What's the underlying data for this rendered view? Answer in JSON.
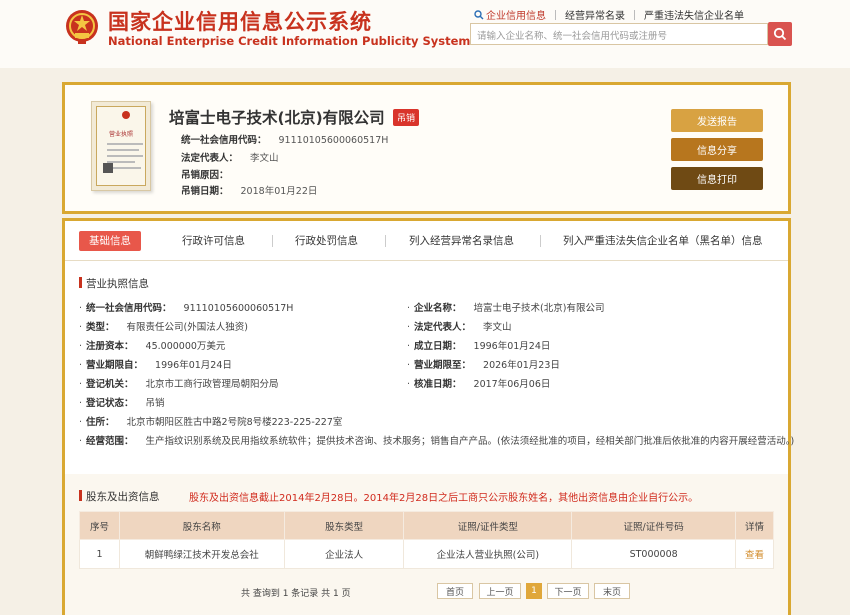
{
  "header": {
    "title_cn": "国家企业信用信息公示系统",
    "title_en": "National Enterprise Credit Information Publicity System",
    "links": [
      "企业信用信息",
      "经营异常名录",
      "严重违法失信企业名单"
    ],
    "search_placeholder": "请输入企业名称、统一社会信用代码或注册号"
  },
  "company": {
    "license_label": "营业执照",
    "name": "培富士电子技术(北京)有限公司",
    "status_badge": "吊销",
    "rows": [
      {
        "label": "统一社会信用代码：",
        "value": "91110105600060517H"
      },
      {
        "label": "法定代表人：",
        "value": "李文山"
      },
      {
        "label": "吊销原因：",
        "value": ""
      },
      {
        "label": "吊销日期：",
        "value": "2018年01月22日"
      }
    ],
    "buttons": [
      "发送报告",
      "信息分享",
      "信息打印"
    ]
  },
  "tabs": [
    "基础信息",
    "行政许可信息",
    "行政处罚信息",
    "列入经营异常名录信息",
    "列入严重违法失信企业名单（黑名单）信息"
  ],
  "license_section": {
    "title": "营业执照信息",
    "left": [
      {
        "label": "统一社会信用代码：",
        "value": "91110105600060517H"
      },
      {
        "label": "类型：",
        "value": "有限责任公司(外国法人独资)"
      },
      {
        "label": "注册资本：",
        "value": "45.000000万美元"
      },
      {
        "label": "营业期限自：",
        "value": "1996年01月24日"
      },
      {
        "label": "登记机关：",
        "value": "北京市工商行政管理局朝阳分局"
      },
      {
        "label": "登记状态：",
        "value": "吊销"
      },
      {
        "label": "住所：",
        "value": "北京市朝阳区胜古中路2号院8号楼223-225-227室"
      },
      {
        "label": "经营范围：",
        "value": "生产指纹识别系统及民用指纹系统软件；提供技术咨询、技术服务；销售自产产品。(依法须经批准的项目，经相关部门批准后依批准的内容开展经营活动。)"
      }
    ],
    "right": [
      {
        "label": "企业名称：",
        "value": "培富士电子技术(北京)有限公司"
      },
      {
        "label": "法定代表人：",
        "value": "李文山"
      },
      {
        "label": "成立日期：",
        "value": "1996年01月24日"
      },
      {
        "label": "营业期限至：",
        "value": "2026年01月23日"
      },
      {
        "label": "核准日期：",
        "value": "2017年06月06日"
      }
    ]
  },
  "shareholders": {
    "title": "股东及出资信息",
    "note": "股东及出资信息截止2014年2月28日。2014年2月28日之后工商只公示股东姓名，其他出资信息由企业自行公示。",
    "columns": [
      "序号",
      "股东名称",
      "股东类型",
      "证照/证件类型",
      "证照/证件号码",
      "详情"
    ],
    "rows": [
      [
        "1",
        "朝鲜鸭绿江技术开发总会社",
        "企业法人",
        "企业法人营业执照(公司)",
        "ST000008",
        "查看"
      ]
    ],
    "pager": {
      "info": "共 查询到 1 条记录 共 1 页",
      "first": "首页",
      "prev": "上一页",
      "current": "1",
      "next": "下一页",
      "last": "末页"
    }
  },
  "colors": {
    "brand_red": "#c8321e",
    "gold_border": "#d9a832",
    "btn_send": "#d8a242",
    "btn_share": "#b7761e",
    "btn_print": "#6f4a14"
  }
}
